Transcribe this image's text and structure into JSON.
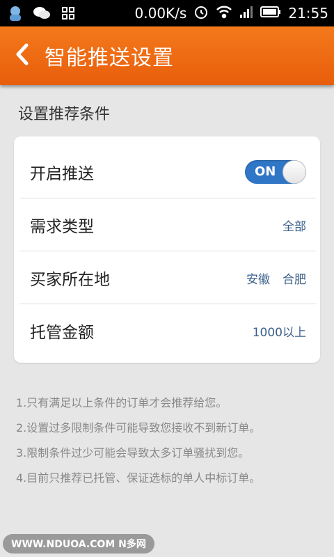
{
  "status_bar": {
    "icons_left": [
      "app-icon",
      "wechat-icon",
      "apps-grid-icon"
    ],
    "speed": "0.00K/s",
    "time": "21:55",
    "icons_right": [
      "alarm-icon",
      "wifi-icon",
      "signal-icon",
      "battery-icon"
    ]
  },
  "header": {
    "back_icon": "chevron-left-icon",
    "title": "智能推送设置",
    "bg_color": "#e96410"
  },
  "section": {
    "title": "设置推荐条件"
  },
  "settings": {
    "push": {
      "label": "开启推送",
      "toggle_label": "ON",
      "enabled": true
    },
    "demand_type": {
      "label": "需求类型",
      "value": "全部"
    },
    "buyer_location": {
      "label": "买家所在地",
      "province": "安徽",
      "city": "合肥"
    },
    "escrow_amount": {
      "label": "托管金额",
      "value": "1000以上"
    }
  },
  "notes": [
    "1.只有满足以上条件的订单才会推荐给您。",
    "2.设置过多限制条件可能导致您接收不到新订单。",
    "3.限制条件过少可能会导致太多订单骚扰到您。",
    "4.目前只推荐已托管、保证选标的单人中标订单。"
  ],
  "watermark": "WWW.NDUOA.COM N多网",
  "colors": {
    "accent": "#e96410",
    "link": "#3a5f89",
    "toggle_on": "#2f76c7"
  }
}
